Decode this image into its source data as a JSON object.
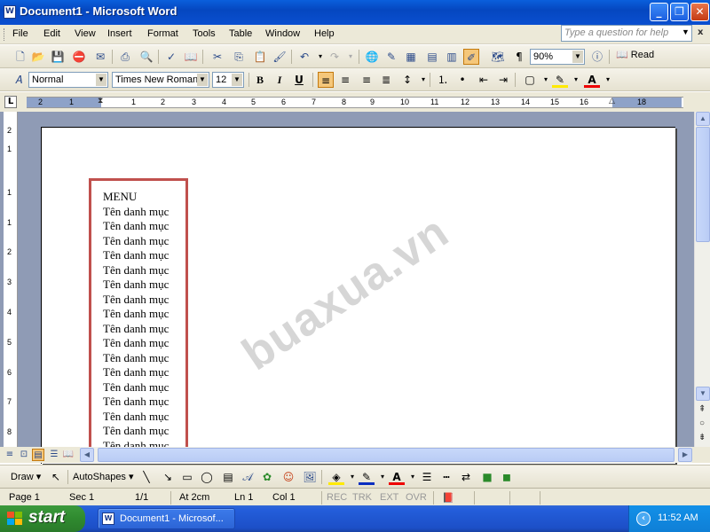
{
  "window": {
    "title": "Document1 - Microsoft Word",
    "app_icon": "W",
    "minimize_icon": "_",
    "restore_icon": "❐",
    "close_icon": "✕"
  },
  "menu": {
    "items": [
      "File",
      "Edit",
      "View",
      "Insert",
      "Format",
      "Tools",
      "Table",
      "Window",
      "Help"
    ],
    "help_placeholder": "Type a question for help",
    "close_icon": "x"
  },
  "standard_toolbar": {
    "zoom": "90%",
    "read_label": "Read",
    "icons": [
      "new-icon",
      "open-icon",
      "save-icon",
      "permission-icon",
      "email-icon",
      "print-icon",
      "print-preview-icon",
      "spelling-icon",
      "research-icon",
      "cut-icon",
      "copy-icon",
      "paste-icon",
      "format-painter-icon",
      "undo-icon",
      "redo-icon",
      "hyperlink-icon",
      "tables-borders-icon",
      "insert-table-icon",
      "insert-excel-icon",
      "columns-icon",
      "drawing-icon",
      "document-map-icon",
      "show-hide-icon"
    ]
  },
  "formatting_toolbar": {
    "style": "Normal",
    "font": "Times New Roman",
    "size": "12",
    "bold": "B",
    "italic": "I",
    "underline": "U"
  },
  "ruler": {
    "numbers": [
      "2",
      "1",
      "1",
      "2",
      "3",
      "4",
      "5",
      "6",
      "7",
      "8",
      "9",
      "10",
      "11",
      "12",
      "13",
      "14",
      "15",
      "16",
      "18"
    ],
    "vertical_numbers": [
      "2",
      "1",
      "1",
      "1",
      "2",
      "3",
      "4",
      "5",
      "6",
      "7",
      "8"
    ]
  },
  "document": {
    "lines": [
      "MENU",
      "Tên danh mục",
      "Tên danh mục",
      "Tên danh mục",
      "Tên danh mục",
      "Tên danh mục",
      "Tên danh mục",
      "Tên danh mục",
      "Tên danh mục",
      "Tên danh mục",
      "Tên danh mục",
      "Tên danh mục",
      "Tên danh mục",
      "Tên danh mục",
      "Tên danh mục",
      "Tên danh mục",
      "Tên danh mục",
      "Tên danh mục"
    ],
    "watermark": "buaxua.vn",
    "textbox_border_color": "#c0504d"
  },
  "drawing_toolbar": {
    "draw_label": "Draw",
    "autoshapes_label": "AutoShapes"
  },
  "status": {
    "page": "Page  1",
    "sec": "Sec  1",
    "pages": "1/1",
    "at": "At  2cm",
    "ln": "Ln  1",
    "col": "Col  1",
    "rec": "REC",
    "trk": "TRK",
    "ext": "EXT",
    "ovr": "OVR"
  },
  "taskbar": {
    "start_label": "start",
    "task_label": "Document1 - Microsof...",
    "clock": "11:52 AM"
  },
  "colors": {
    "titlebar": "#0547c0",
    "accent_border": "#c0504d",
    "start_green": "#2f8a2f"
  }
}
